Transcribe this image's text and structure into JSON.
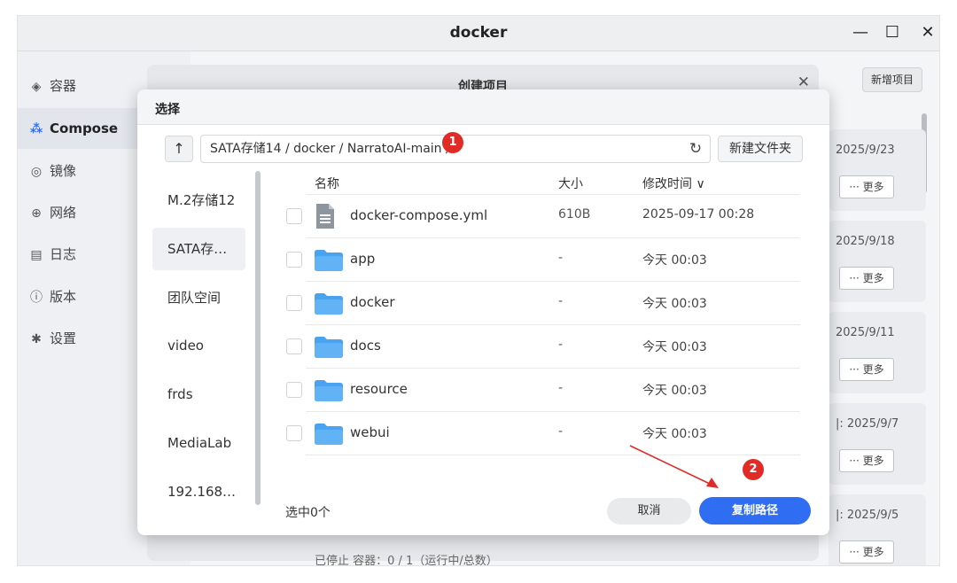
{
  "window": {
    "title": "docker",
    "minimize_glyph": "—",
    "maximize_glyph": "☐",
    "close_glyph": "✕"
  },
  "sidebar": {
    "items": [
      {
        "label": "容器",
        "icon": "layers-icon",
        "active": false
      },
      {
        "label": "Compose",
        "icon": "compose-icon",
        "active": true
      },
      {
        "label": "镜像",
        "icon": "image-icon",
        "active": false
      },
      {
        "label": "网络",
        "icon": "globe-icon",
        "active": false
      },
      {
        "label": "日志",
        "icon": "log-icon",
        "active": false
      },
      {
        "label": "版本",
        "icon": "info-icon",
        "active": false
      },
      {
        "label": "设置",
        "icon": "gear-icon",
        "active": false
      }
    ]
  },
  "content": {
    "add_project_label": "新增项目",
    "projects": [
      {
        "date": "2025/9/23",
        "more_label": "··· 更多"
      },
      {
        "date": "2025/9/18",
        "more_label": "··· 更多"
      },
      {
        "date": "2025/9/11",
        "more_label": "··· 更多"
      },
      {
        "date": "|: 2025/9/7",
        "more_label": "··· 更多"
      },
      {
        "date": "|: 2025/9/5",
        "more_label": "··· 更多"
      }
    ],
    "behind_status_text": "已停止    容器：0 / 1（运行中/总数）"
  },
  "create_dialog": {
    "title": "创建项目",
    "close_glyph": "✕"
  },
  "select_dialog": {
    "title": "选择",
    "up_glyph": "↑",
    "path": "SATA存储14 / docker / NarratoAI-main /",
    "refresh_glyph": "↻",
    "new_folder_label": "新建文件夹",
    "locations": [
      {
        "label": "M.2存储12",
        "selected": false
      },
      {
        "label": "SATA存…",
        "selected": true
      },
      {
        "label": "团队空间",
        "selected": false
      },
      {
        "label": "video",
        "selected": false
      },
      {
        "label": "frds",
        "selected": false
      },
      {
        "label": "MediaLab",
        "selected": false
      },
      {
        "label": "192.168…",
        "selected": false
      }
    ],
    "columns": {
      "name": "名称",
      "size": "大小",
      "modified": "修改时间 ∨"
    },
    "files": [
      {
        "name": "docker-compose.yml",
        "size": "610B",
        "modified": "2025-09-17 00:28",
        "type": "file"
      },
      {
        "name": "app",
        "size": "-",
        "modified": "今天 00:03",
        "type": "folder"
      },
      {
        "name": "docker",
        "size": "-",
        "modified": "今天 00:03",
        "type": "folder"
      },
      {
        "name": "docs",
        "size": "-",
        "modified": "今天 00:03",
        "type": "folder"
      },
      {
        "name": "resource",
        "size": "-",
        "modified": "今天 00:03",
        "type": "folder"
      },
      {
        "name": "webui",
        "size": "-",
        "modified": "今天 00:03",
        "type": "folder"
      }
    ],
    "selected_count": "选中0个",
    "cancel_label": "取消",
    "copy_path_label": "复制路径"
  },
  "annotations": {
    "badge_1": "1",
    "badge_2": "2",
    "badge_color": "#e02b27"
  },
  "colors": {
    "primary": "#2f6df3",
    "folder": "#4aa3f0"
  }
}
